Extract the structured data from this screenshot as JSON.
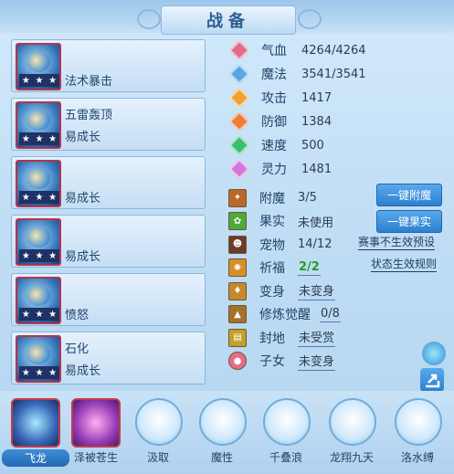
{
  "title": "战备",
  "cards": [
    {
      "line1": "",
      "line2": "法术暴击"
    },
    {
      "line1": "五雷轰顶",
      "line2": "易成长"
    },
    {
      "line1": "",
      "line2": "易成长"
    },
    {
      "line1": "",
      "line2": "易成长"
    },
    {
      "line1": "",
      "line2": "愤怒"
    },
    {
      "line1": "石化",
      "line2": "易成长"
    }
  ],
  "stats": [
    {
      "label": "气血",
      "value": "4264/4264",
      "icon": "heart-icon",
      "color": "#e46b86"
    },
    {
      "label": "魔法",
      "value": "3541/3541",
      "icon": "mana-icon",
      "color": "#58a6e6"
    },
    {
      "label": "攻击",
      "value": "1417",
      "icon": "attack-icon",
      "color": "#f2a132"
    },
    {
      "label": "防御",
      "value": "1384",
      "icon": "defense-icon",
      "color": "#ee7d3c"
    },
    {
      "label": "速度",
      "value": "500",
      "icon": "speed-icon",
      "color": "#3cbf6a"
    },
    {
      "label": "灵力",
      "value": "1481",
      "icon": "spirit-icon",
      "color": "#d079d8"
    }
  ],
  "attributes": [
    {
      "label": "附魔",
      "value": "3/5",
      "underline": false,
      "icon": "enchant-icon",
      "color": "#b9692a"
    },
    {
      "label": "果实",
      "value": "未使用",
      "underline": false,
      "icon": "fruit-icon",
      "color": "#4ca93c"
    },
    {
      "label": "宠物",
      "value": "14/12",
      "underline": false,
      "icon": "pet-icon",
      "color": "#6b3a2a"
    },
    {
      "label": "祈福",
      "value": "2/2",
      "underline": true,
      "green": true,
      "icon": "blessing-icon",
      "color": "#d6902a"
    },
    {
      "label": "变身",
      "value": "未变身",
      "underline": true,
      "icon": "transform-icon",
      "color": "#c7882f"
    },
    {
      "label": "修炼觉醒",
      "value": "0/8",
      "underline": true,
      "icon": "cultivation-icon",
      "color": "#a8702a"
    },
    {
      "label": "封地",
      "value": "未受赏",
      "underline": true,
      "icon": "fief-icon",
      "color": "#c5a02a"
    },
    {
      "label": "子女",
      "value": "未变身",
      "underline": true,
      "icon": "children-icon",
      "color": "#e76b86"
    }
  ],
  "buttons": {
    "enchant": "一键附魔",
    "fruit": "一键果实"
  },
  "links": {
    "preset": "赛事不生效预设",
    "rules": "状态生效规则"
  },
  "skills": [
    {
      "name": "飞龙",
      "active": true
    },
    {
      "name": "泽被苍生",
      "active": false,
      "red": true
    },
    {
      "name": "汲取",
      "active": false
    },
    {
      "name": "魔性",
      "active": false
    },
    {
      "name": "千叠浪",
      "active": false
    },
    {
      "name": "龙翔九天",
      "active": false
    },
    {
      "name": "洛水缚",
      "active": false
    }
  ]
}
